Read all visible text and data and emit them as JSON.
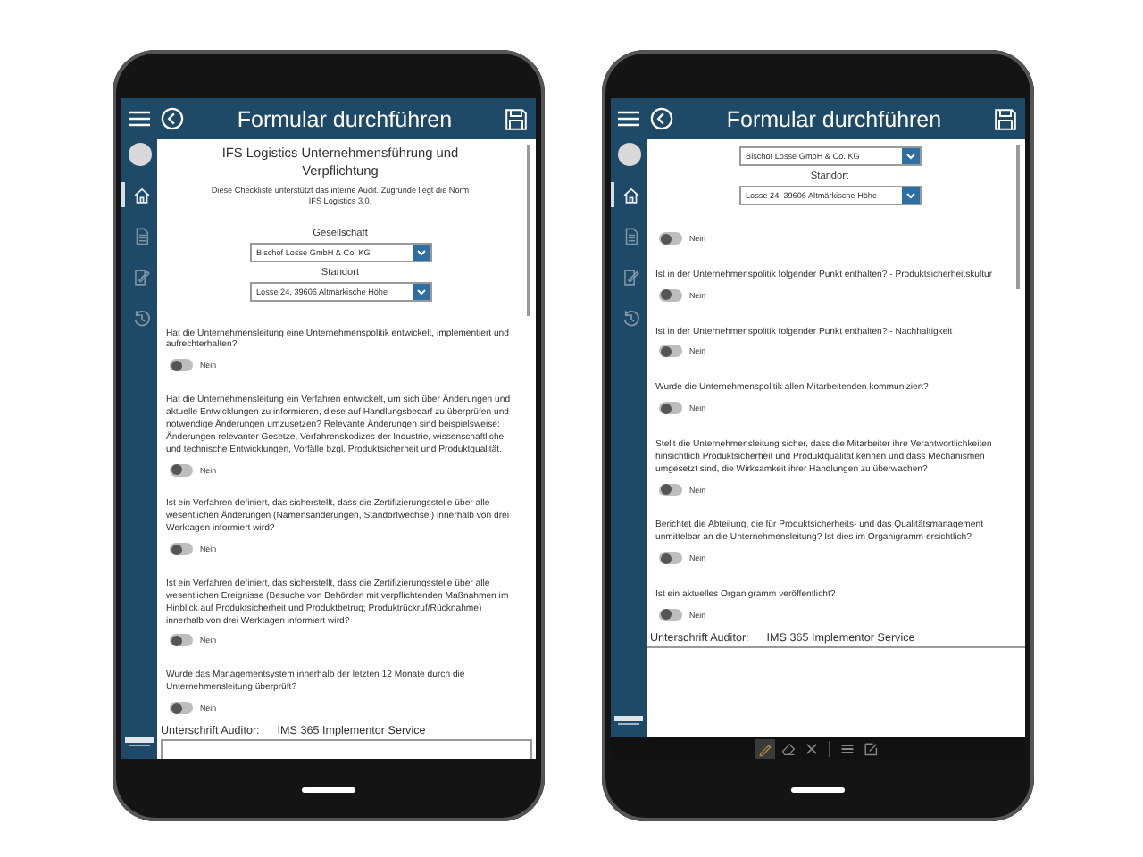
{
  "phones": [
    {
      "header": {
        "title": "Formular durchführen"
      },
      "sidebar": {
        "items": [
          {
            "kind": "home",
            "selected": true
          },
          {
            "kind": "document",
            "selected": false
          },
          {
            "kind": "edit",
            "selected": false
          },
          {
            "kind": "history",
            "selected": false
          }
        ]
      },
      "form": {
        "title": "IFS Logistics Unternehmensführung und Verpflichtung",
        "description": "Diese Checkliste unterstützt das interne Audit. Zugrunde liegt die Norm IFS Logistics 3.0.",
        "fields": [
          {
            "label": "Gesellschaft",
            "value": "Bischof Losse GmbH & Co. KG"
          },
          {
            "label": "Standort",
            "value": "Losse 24, 39606 Altmärkische Höhe"
          }
        ],
        "questions": [
          {
            "text": "Hat die Unternehmensleitung eine Unternehmenspolitik entwickelt, implementiert und aufrechterhalten?",
            "on": false,
            "answer": "Nein"
          },
          {
            "text": "Hat die Unternehmensleitung ein Verfahren entwickelt, um sich über Änderungen und aktuelle Entwicklungen zu informieren, diese auf Handlungsbedarf zu überprüfen und notwendige Änderungen umzusetzen? Relevante Änderungen sind beispielsweise: Änderungen relevanter Gesetze, Verfahrenskodizes der Industrie, wissenschaftliche und technische Entwicklungen, Vorfälle bzgl. Produktsicherheit und Produktqualität.",
            "on": false,
            "answer": "Nein"
          },
          {
            "text": "Ist ein Verfahren definiert, das sicherstellt, dass die Zertifizierungsstelle über alle wesentlichen Änderungen (Namensänderungen, Standortwechsel) innerhalb von drei Werktagen informiert wird?",
            "on": false,
            "answer": "Nein"
          },
          {
            "text": "Ist ein Verfahren definiert, das sicherstellt, dass die Zertifizierungsstelle über alle wesentlichen Ereignisse (Besuche von Behörden mit verpflichtenden Maßnahmen im Hinblick auf Produktsicherheit und Produktbetrug; Produktrückruf/Rücknahme) innerhalb von drei Werktagen informiert wird?",
            "on": false,
            "answer": "Nein"
          },
          {
            "text": "Wurde das Managementsystem innerhalb der letzten 12 Monate durch die Unternehmensleitung überprüft?",
            "on": false,
            "answer": "Nein"
          }
        ]
      },
      "signature": {
        "label": "Unterschrift Auditor:",
        "value": "IMS 365 Implementor Service",
        "pad": false
      }
    },
    {
      "header": {
        "title": "Formular durchführen"
      },
      "sidebar": {
        "items": [
          {
            "kind": "home",
            "selected": true
          },
          {
            "kind": "document",
            "selected": false
          },
          {
            "kind": "edit",
            "selected": false
          },
          {
            "kind": "history",
            "selected": false
          }
        ]
      },
      "form": {
        "fields": [
          {
            "value": "Bischof Losse GmbH & Co. KG"
          },
          {
            "label": "Standort",
            "value": "Losse 24, 39606 Altmärkische Höhe"
          }
        ],
        "questions": [
          {
            "on": false,
            "answer": "Nein"
          },
          {
            "text": "Ist in der Unternehmenspolitik folgender Punkt enthalten? - Produktsicherheitskultur",
            "on": false,
            "answer": "Nein"
          },
          {
            "text": "Ist in der Unternehmenspolitik folgender Punkt enthalten? - Nachhaltigkeit",
            "on": false,
            "answer": "Nein"
          },
          {
            "text": "Wurde die Unternehmenspolitik allen Mitarbeitenden kommuniziert?",
            "on": false,
            "answer": "Nein"
          },
          {
            "text": "Stellt die Unternehmensleitung sicher, dass die Mitarbeiter ihre Verantwortlichkeiten hinsichtlich Produktsicherheit und Produktqualität kennen und dass Mechanismen umgesetzt sind, die Wirksamkeit ihrer Handlungen zu überwachen?",
            "on": false,
            "answer": "Nein"
          },
          {
            "text": "Berichtet die Abteilung, die für Produktsicherheits- und das Qualitätsmanagement unmittelbar an die Unternehmensleitung? Ist dies im Organigramm ersichtlich?",
            "on": false,
            "answer": "Nein"
          },
          {
            "text": "Ist ein aktuelles Organigramm veröffentlicht?",
            "on": false,
            "answer": "Nein"
          }
        ]
      },
      "signature": {
        "label": "Unterschrift Auditor:",
        "value": "IMS 365 Implementor Service",
        "pad": true
      },
      "toolbar": {
        "tools": [
          {
            "kind": "pen",
            "selected": true
          },
          {
            "kind": "eraser",
            "selected": false
          },
          {
            "kind": "clear",
            "selected": false
          },
          {
            "kind": "lines",
            "selected": false
          },
          {
            "kind": "edit",
            "selected": false
          }
        ]
      }
    }
  ]
}
